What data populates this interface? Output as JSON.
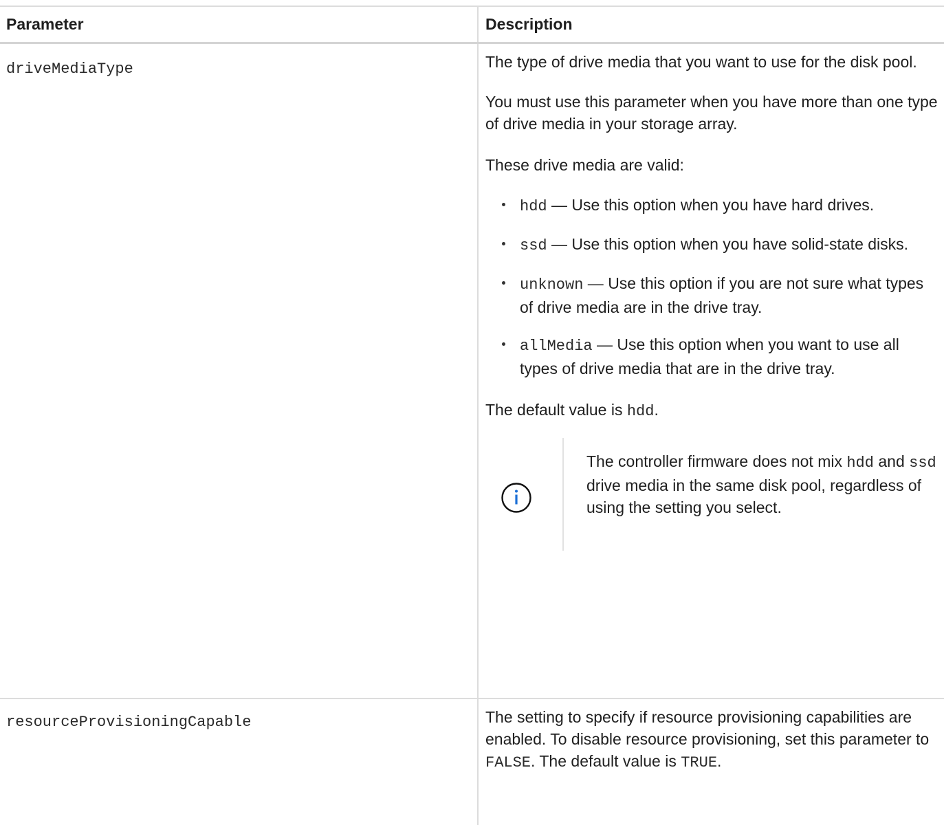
{
  "table": {
    "header": {
      "parameter": "Parameter",
      "description": "Description"
    },
    "rows": [
      {
        "parameter": "driveMediaType",
        "desc_intro": "The type of drive media that you want to use for the disk pool.",
        "desc_must": "You must use this parameter when you have more than one type of drive media in your storage array.",
        "desc_valid": "These drive media are valid:",
        "options": [
          {
            "code": "hdd",
            "text": " — Use this option when you have hard drives."
          },
          {
            "code": "ssd",
            "text": " — Use this option when you have solid-state disks."
          },
          {
            "code": "unknown",
            "text": " — Use this option if you are not sure what types of drive media are in the drive tray."
          },
          {
            "code": "allMedia",
            "text": " — Use this option when you want to use all types of drive media that are in the drive tray."
          }
        ],
        "default_prefix": "The default value is ",
        "default_code": "hdd",
        "default_suffix": ".",
        "note": {
          "icon": "info-icon",
          "t1": "The controller firmware does not mix ",
          "code1": "hdd",
          "t2": " and ",
          "code2": "ssd",
          "t3": " drive media in the same disk pool, regardless of using the setting you select."
        }
      },
      {
        "parameter": "resourceProvisioningCapable",
        "t1": "The setting to specify if resource provisioning capabilities are enabled. To disable resource provisioning, set this parameter to ",
        "code1": "FALSE",
        "t2": ". The default value is ",
        "code2": "TRUE",
        "t3": "."
      }
    ]
  },
  "colors": {
    "text": "#1f1f1f",
    "border": "#dcdcdc",
    "icon": "#1b6fd6"
  }
}
